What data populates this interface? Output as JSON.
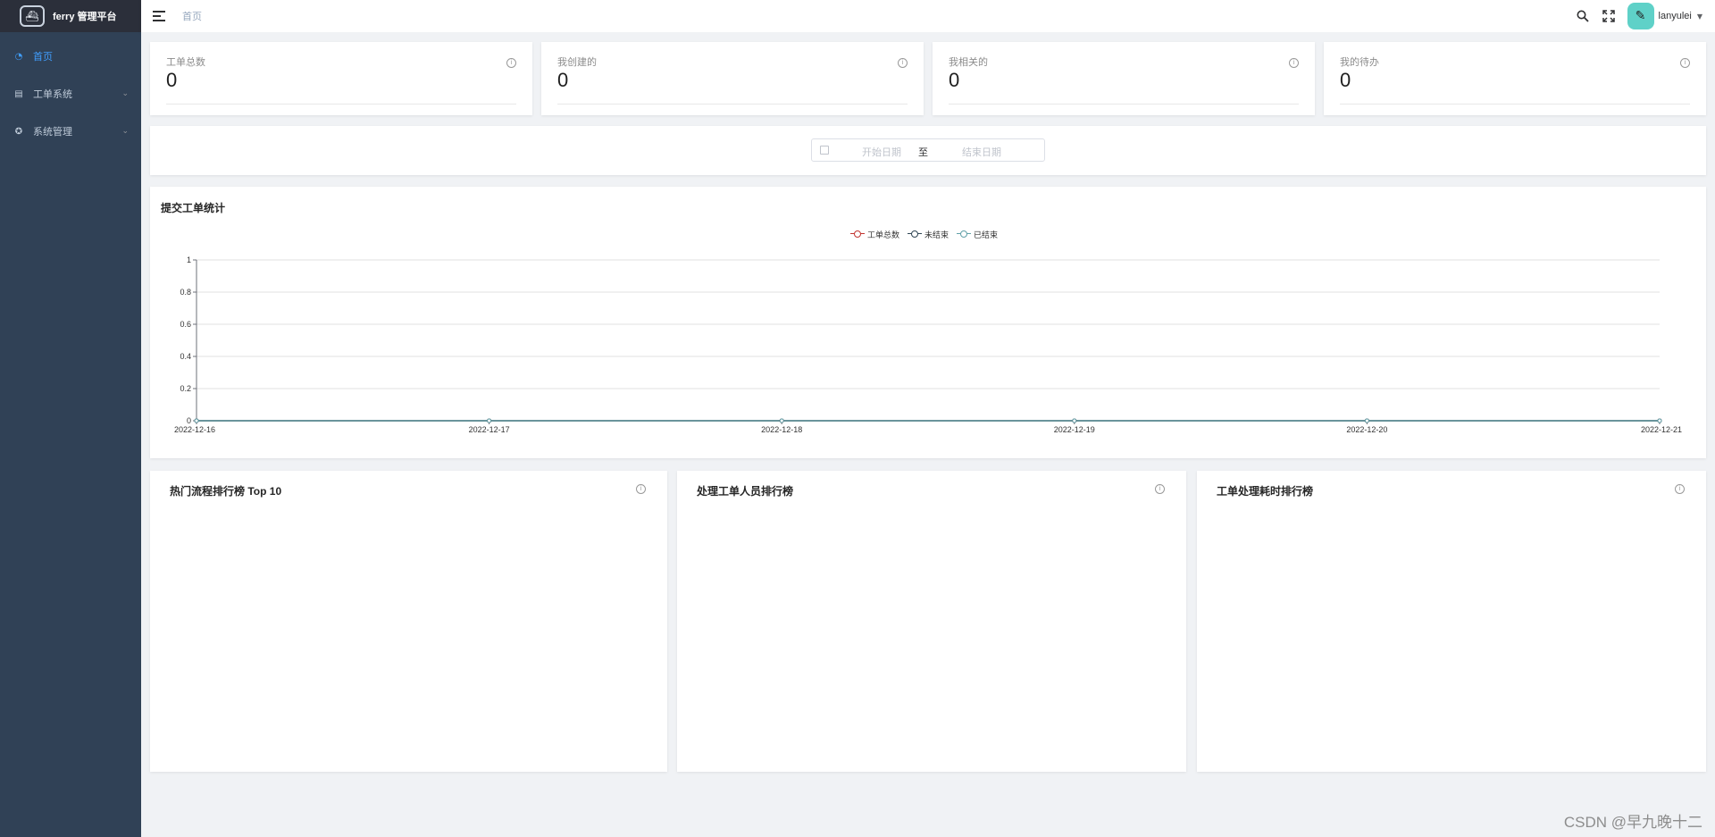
{
  "app": {
    "title": "ferry 管理平台"
  },
  "sidebar": {
    "items": [
      {
        "label": "首页",
        "icon": "dashboard-icon",
        "active": true
      },
      {
        "label": "工单系统",
        "icon": "ticket-icon",
        "active": false
      },
      {
        "label": "系统管理",
        "icon": "settings-icon",
        "active": false
      }
    ]
  },
  "navbar": {
    "breadcrumb": "首页",
    "username": "lanyulei"
  },
  "stats": [
    {
      "title": "工单总数",
      "value": "0"
    },
    {
      "title": "我创建的",
      "value": "0"
    },
    {
      "title": "我相关的",
      "value": "0"
    },
    {
      "title": "我的待办",
      "value": "0"
    }
  ],
  "date_filter": {
    "start_placeholder": "开始日期",
    "separator": "至",
    "end_placeholder": "结束日期"
  },
  "submit_stats": {
    "title": "提交工单统计"
  },
  "chart_data": {
    "type": "line",
    "x": [
      "2022-12-16",
      "2022-12-17",
      "2022-12-18",
      "2022-12-19",
      "2022-12-20",
      "2022-12-21"
    ],
    "series": [
      {
        "name": "工单总数",
        "values": [
          0,
          0,
          0,
          0,
          0,
          0
        ],
        "color": "#c23531"
      },
      {
        "name": "未结束",
        "values": [
          0,
          0,
          0,
          0,
          0,
          0
        ],
        "color": "#2f4554"
      },
      {
        "name": "已结束",
        "values": [
          0,
          0,
          0,
          0,
          0,
          0
        ],
        "color": "#61a0a8"
      }
    ],
    "ylim": [
      0,
      1
    ],
    "yticks": [
      "0",
      "0.2",
      "0.4",
      "0.6",
      "0.8",
      "1"
    ],
    "grid": true,
    "legend": "top-center"
  },
  "rankings": [
    {
      "title": "热门流程排行榜 Top 10"
    },
    {
      "title": "处理工单人员排行榜"
    },
    {
      "title": "工单处理耗时排行榜"
    }
  ],
  "watermark": "CSDN @早九晚十二"
}
